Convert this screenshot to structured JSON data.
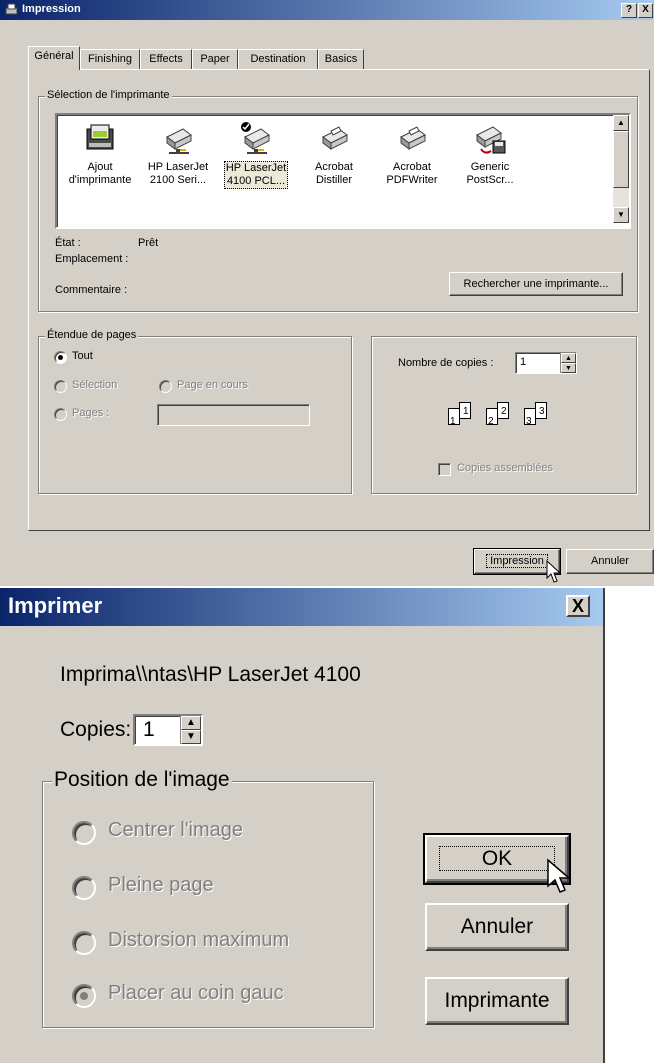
{
  "dialog1": {
    "title": "Impression",
    "help_label": "?",
    "close_label": "X",
    "tabs": [
      {
        "label": "Général",
        "active": true
      },
      {
        "label": "Finishing"
      },
      {
        "label": "Effects"
      },
      {
        "label": "Paper"
      },
      {
        "label": "Destination"
      },
      {
        "label": "Basics"
      }
    ],
    "printer_group_label": "Sélection de l'imprimante",
    "printers": [
      {
        "line1": "Ajout",
        "line2": "d'imprimante",
        "icon": "add-printer-icon"
      },
      {
        "line1": "HP LaserJet",
        "line2": "2100 Seri...",
        "icon": "network-printer-icon"
      },
      {
        "line1": "HP LaserJet",
        "line2": "4100 PCL...",
        "icon": "default-network-printer-icon",
        "selected": true
      },
      {
        "line1": "Acrobat",
        "line2": "Distiller",
        "icon": "printer-icon"
      },
      {
        "line1": "Acrobat",
        "line2": "PDFWriter",
        "icon": "printer-icon"
      },
      {
        "line1": "Generic",
        "line2": "PostScr...",
        "icon": "file-printer-icon"
      }
    ],
    "status_label": "État :",
    "status_value": "Prêt",
    "location_label": "Emplacement :",
    "comment_label": "Commentaire :",
    "find_printer_label": "Rechercher une imprimante...",
    "range_group_label": "Étendue de pages",
    "range_all": "Tout",
    "range_selection": "Sélection",
    "range_current": "Page en cours",
    "range_pages": "Pages :",
    "copies_label": "Nombre de copies :",
    "copies_value": "1",
    "collate_label": "Copies assemblées",
    "collate_icons": [
      "1",
      "1",
      "2",
      "2",
      "3",
      "3"
    ],
    "print_button": "Impression",
    "cancel_button": "Annuler"
  },
  "dialog2": {
    "title": "Imprimer",
    "close_label": "X",
    "printer_line": "Imprima\\\\ntas\\HP LaserJet 4100",
    "copies_label": "Copies:",
    "copies_value": "1",
    "position_group_label": "Position de l'image",
    "options": [
      "Centrer l'image",
      "Pleine page",
      "Distorsion maximum",
      "Placer au coin gauc"
    ],
    "selected_option": 3,
    "ok_button": "OK",
    "cancel_button": "Annuler",
    "printer_button": "Imprimante"
  },
  "colors": {
    "face": "#d4d0c8",
    "title_start": "#0a246a",
    "title_end": "#a6caf0"
  }
}
